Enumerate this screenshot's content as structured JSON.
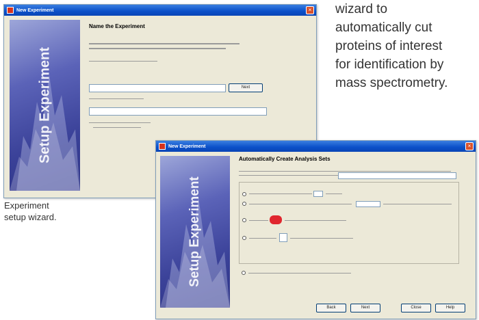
{
  "window1": {
    "title": "New Experiment",
    "heading": "Name the Experiment",
    "banner_text": "Setup Experiment",
    "browse_button": "Next"
  },
  "window2": {
    "title": "New Experiment",
    "heading": "Automatically Create Analysis Sets",
    "banner_text": "Setup Experiment",
    "buttons": [
      "Back",
      "Next",
      "Close",
      "Help"
    ]
  },
  "caption_left": [
    "Experiment",
    "setup wizard."
  ],
  "caption_right": [
    "wizard to",
    "automatically cut",
    "proteins of interest",
    "for identification by",
    "mass spectrometry."
  ],
  "colors": {
    "titlebar": "#0a4fc8",
    "banner": "#3b4299",
    "badge": "#e0262e"
  }
}
